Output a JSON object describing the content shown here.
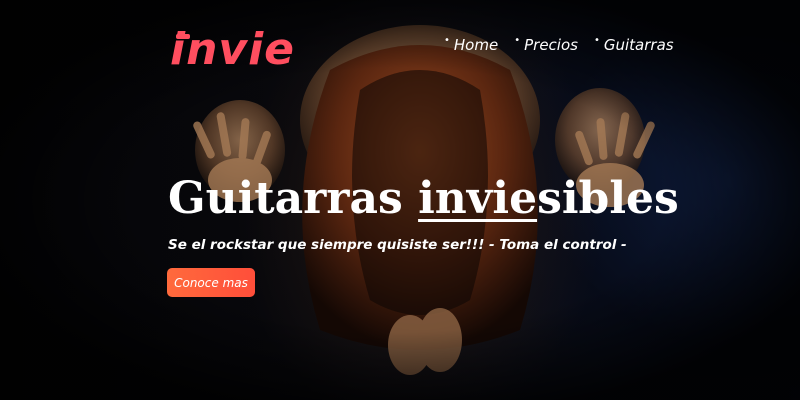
{
  "brand": {
    "logo_text": "invie",
    "accent_color": "#ff4e5f"
  },
  "nav": {
    "items": [
      {
        "label": "Home"
      },
      {
        "label": "Precios"
      },
      {
        "label": "Guitarras"
      }
    ],
    "bullet": "•"
  },
  "hero": {
    "title_prefix": "Guitarras ",
    "title_underlined": "invie",
    "title_suffix": "sibles",
    "subtitle": "Se el rockstar que siempre quisiste ser!!! - Toma el control -",
    "cta_label": "Conoce mas",
    "cta_color": "#ff5a3a"
  }
}
